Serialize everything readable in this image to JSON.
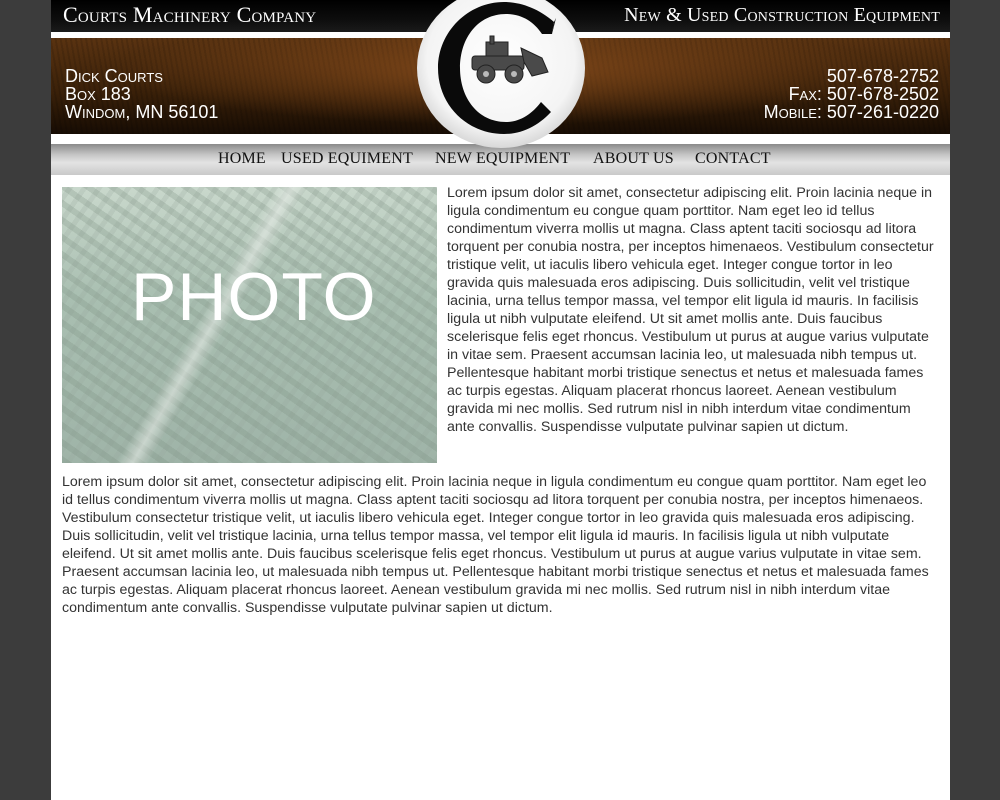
{
  "header": {
    "company_name": "Courts Machinery Company",
    "tagline": "New & Used Construction Equipment",
    "address": {
      "name": "Dick Courts",
      "box": "Box 183",
      "city": "Windom, MN 56101"
    },
    "phones": {
      "main": "507-678-2752",
      "fax": "Fax: 507-678-2502",
      "mobile": "Mobile: 507-261-0220"
    },
    "logo_icon": "c-loader-logo"
  },
  "nav": {
    "items": [
      "HOME",
      "USED EQUIMENT",
      "NEW EQUIPMENT",
      "ABOUT US",
      "CONTACT"
    ]
  },
  "content": {
    "photo_label": "PHOTO",
    "paragraph1": "Lorem ipsum dolor sit amet, consectetur adipiscing elit. Proin lacinia neque in ligula condimentum eu congue quam porttitor. Nam eget leo id tellus condimentum viverra mollis ut magna. Class aptent taciti sociosqu ad litora torquent per conubia nostra, per inceptos himenaeos. Vestibulum consectetur tristique velit, ut iaculis libero vehicula eget. Integer congue tortor in leo gravida quis malesuada eros adipiscing. Duis sollicitudin, velit vel tristique lacinia, urna tellus tempor massa, vel tempor elit ligula id mauris. In facilisis ligula ut nibh vulputate eleifend. Ut sit amet mollis ante. Duis faucibus scelerisque felis eget rhoncus. Vestibulum ut purus at augue varius vulputate in vitae sem. Praesent accumsan lacinia leo, ut malesuada nibh tempus ut. Pellentesque habitant morbi tristique senectus et netus et malesuada fames ac turpis egestas. Aliquam placerat rhoncus laoreet. Aenean vestibulum gravida mi nec mollis. Sed rutrum nisl in nibh interdum vitae condimentum ante convallis. Suspendisse vulputate pulvinar sapien ut dictum.",
    "paragraph2": "Lorem ipsum dolor sit amet, consectetur adipiscing elit. Proin lacinia neque in ligula condimentum eu congue quam porttitor. Nam eget leo id tellus condimentum viverra mollis ut magna. Class aptent taciti sociosqu ad litora torquent per conubia nostra, per inceptos himenaeos. Vestibulum consectetur tristique velit, ut iaculis libero vehicula eget. Integer congue tortor in leo gravida quis malesuada eros adipiscing. Duis sollicitudin, velit vel tristique lacinia, urna tellus tempor massa, vel tempor elit ligula id mauris. In facilisis ligula ut nibh vulputate eleifend. Ut sit amet mollis ante. Duis faucibus scelerisque felis eget rhoncus. Vestibulum ut purus at augue varius vulputate in vitae sem. Praesent accumsan lacinia leo, ut malesuada nibh tempus ut. Pellentesque habitant morbi tristique senectus et netus et malesuada fames ac turpis egestas. Aliquam placerat rhoncus laoreet. Aenean vestibulum gravida mi nec mollis. Sed rutrum nisl in nibh interdum vitae condimentum ante convallis. Suspendisse vulputate pulvinar sapien ut dictum."
  },
  "colors": {
    "page_background": "#3c3c3c",
    "banner_brown": "#3b2109",
    "top_bar": "#000000",
    "body_text": "#333333"
  }
}
